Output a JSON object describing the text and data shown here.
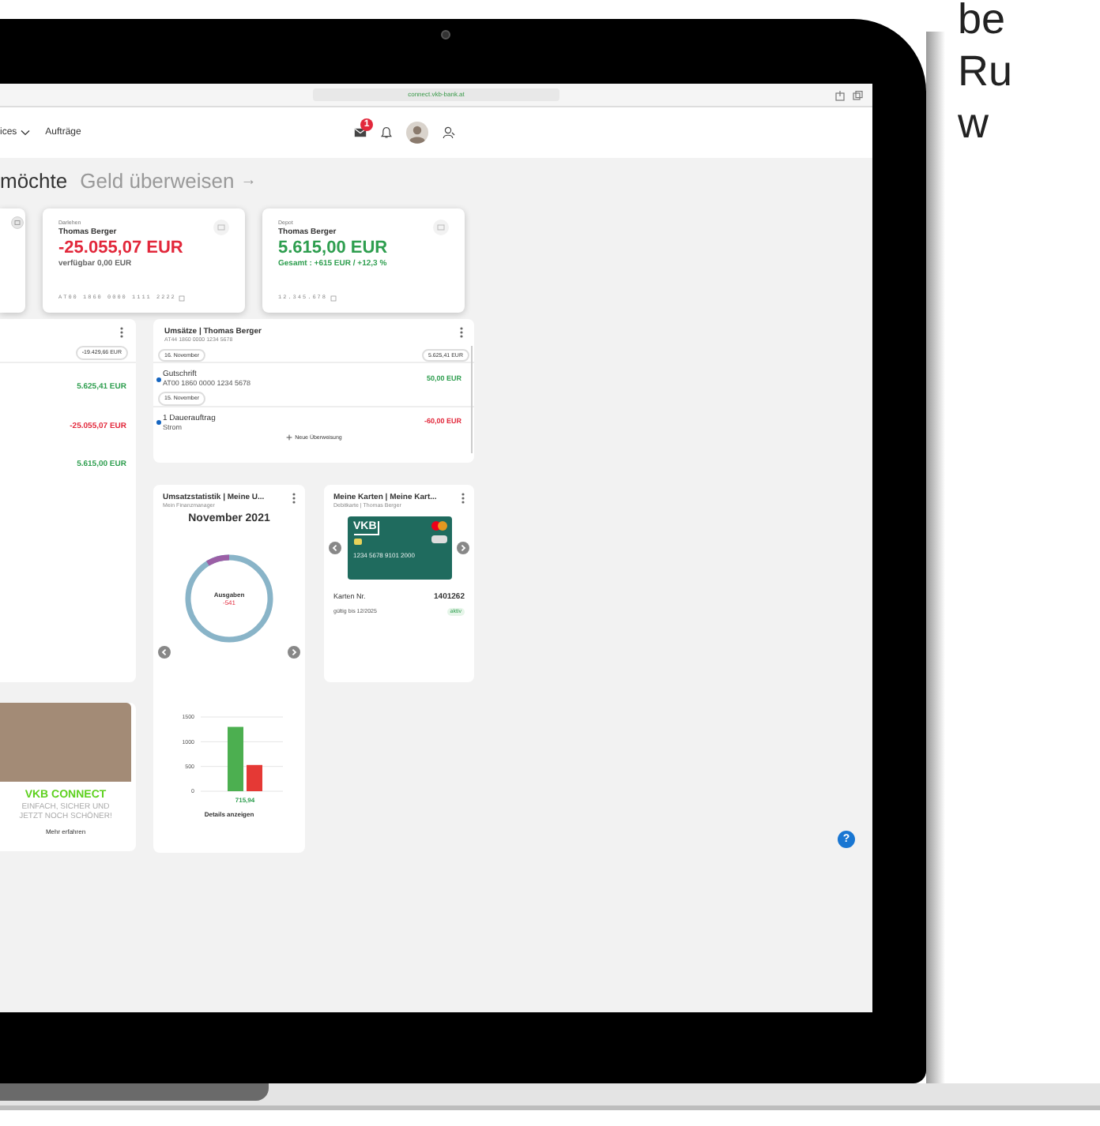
{
  "page_text": [
    "be",
    "Ru",
    "w"
  ],
  "browser": {
    "url": "connect.vkb-bank.at"
  },
  "nav": {
    "items": [
      "ices",
      "Aufträge"
    ],
    "message_badge": "1"
  },
  "greeting": {
    "fragment": "möchte",
    "link": "Geld überweisen",
    "arrow": "→"
  },
  "accounts": [
    {
      "category": "Darlehen",
      "owner": "Thomas Berger",
      "amount": "-25.055,07 EUR",
      "color": "#e2283b",
      "sub": {
        "text": "verfügbar 0,00 EUR",
        "color": "#666666"
      },
      "number": "AT00 1860 0000 1111 2222"
    },
    {
      "category": "Depot",
      "owner": "Thomas Berger",
      "amount": "5.615,00 EUR",
      "color": "#2e9e4f",
      "sub": {
        "text": "Gesamt : +615 EUR / +12,3 %",
        "color": "#2e9e4f"
      },
      "number": "12.345.678"
    }
  ],
  "overview": {
    "total": "-19.429,66 EUR",
    "rows": [
      {
        "amount": "5.625,41 EUR",
        "color": "#2e9e4f"
      },
      {
        "amount": "-25.055,07 EUR",
        "color": "#e2283b"
      },
      {
        "amount": "5.615,00 EUR",
        "color": "#2e9e4f"
      }
    ]
  },
  "promo": {
    "title": "VKB CONNECT",
    "text": "EINFACH, SICHER UND JETZT NOCH SCHÖNER!",
    "link": "Mehr erfahren"
  },
  "transactions": {
    "title": "Umsätze | Thomas Berger",
    "iban": "AT44 1860 0000 1234 5678",
    "groups": [
      {
        "date": "16. November",
        "balance": "5.625,41 EUR",
        "items": [
          {
            "title": "Gutschrift",
            "detail": "AT00 1860 0000 1234 5678",
            "amount": "50,00 EUR",
            "color": "#2e9e4f"
          }
        ]
      },
      {
        "date": "15. November",
        "items": [
          {
            "title": "1 Dauerauftrag",
            "detail": "Strom",
            "amount": "-60,00 EUR",
            "color": "#e2283b"
          }
        ]
      }
    ],
    "action": "Neue Überweisung"
  },
  "stats": {
    "title": "Umsatzstatistik | Meine U...",
    "subtitle": "Mein Finanzmanager",
    "month": "November 2021",
    "donut_label": "Ausgaben",
    "donut_value": "-541",
    "link": "Details anzeigen",
    "chart_data": {
      "type": "bar",
      "yticks": [
        0,
        500,
        1000,
        1500
      ],
      "ylim": [
        0,
        1500
      ],
      "series": [
        {
          "color": "#4caf50",
          "values": [
            1300
          ]
        },
        {
          "color": "#e53935",
          "values": [
            530
          ]
        }
      ],
      "annotations": [
        "715,94"
      ]
    }
  },
  "cards": {
    "title": "Meine Karten | Meine Kart...",
    "subtitle": "Debitkarte | Thomas Berger",
    "brand": "VKB",
    "card_number": "1234 5678 9101 2000",
    "number_label": "Karten Nr.",
    "number": "1401262",
    "valid": "gültig bis 12/2025",
    "status": "aktiv"
  },
  "help": "?"
}
